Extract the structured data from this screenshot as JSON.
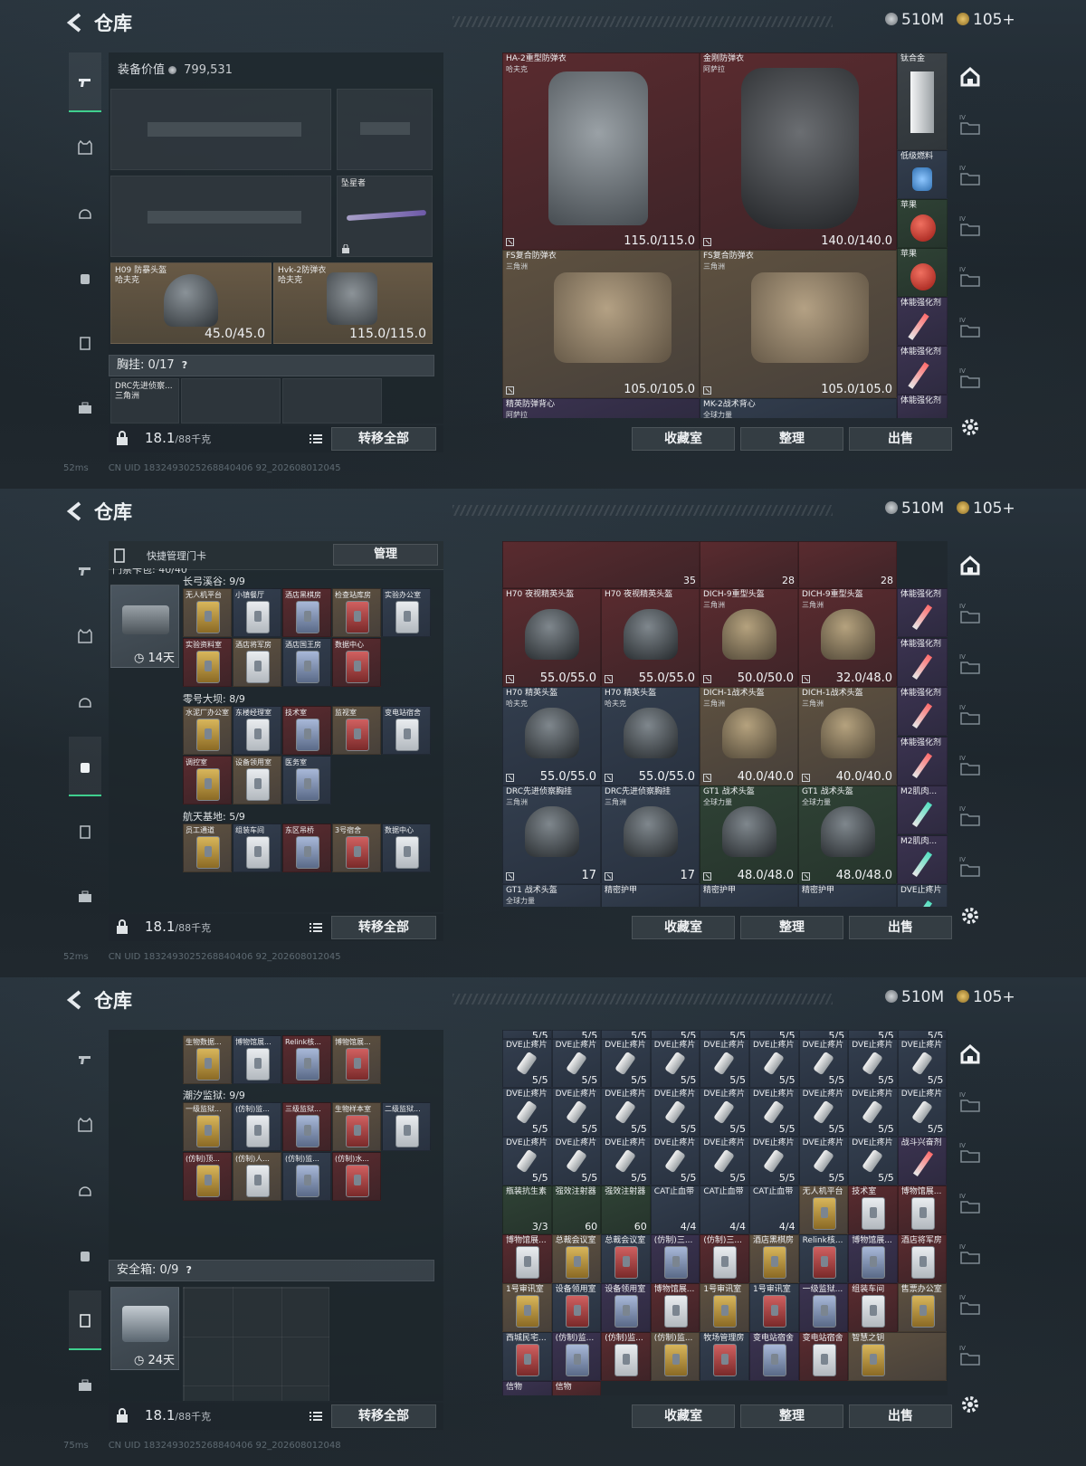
{
  "header": {
    "title": "仓库",
    "currency_silver": "510M",
    "currency_gold": "105+"
  },
  "left": {
    "gear_value_label": "装备价值",
    "gear_value": "799,531",
    "star_slot": "坠星者",
    "helmet": {
      "name": "H09 防暴头盔",
      "sub": "哈夫克",
      "durability": "45.0/45.0"
    },
    "armor": {
      "name": "Hvk-2防弹衣",
      "sub": "哈夫克",
      "durability": "115.0/115.0"
    },
    "chest_label": "胸挂: 0/17",
    "chest_item": "DRC先进侦察...",
    "chest_item_sub": "三角洲",
    "weight": "18.1",
    "weight_unit": "/88千克",
    "transfer_all": "转移全部",
    "quick_card_label": "快捷管理门卡",
    "manage": "管理",
    "card_pack": "门禁卡包: 40/40",
    "days_1": "14天",
    "safe_label": "安全箱: 0/9",
    "days_2": "24天",
    "help": "?"
  },
  "groups": {
    "g1": {
      "title": "长弓溪谷: 9/9",
      "cards": [
        "无人机平台",
        "小镇餐厅",
        "酒店黑棋房",
        "检查站库房",
        "实验办公室",
        "实验资料室",
        "酒店将军房",
        "酒店国王房",
        "数据中心"
      ]
    },
    "g2": {
      "title": "零号大坝: 8/9",
      "cards": [
        "水泥厂办公室",
        "东楼经理室",
        "技术室",
        "监视室",
        "变电站宿舍",
        "调控室",
        "设备领用室",
        "医务室"
      ]
    },
    "g3": {
      "title": "航天基地: 5/9",
      "cards": [
        "员工通道",
        "组装车间",
        "东区吊桥",
        "3号宿舍",
        "数据中心"
      ]
    },
    "g4_top": [
      "生物数据...",
      "博物馆展...",
      "Relink核...",
      "博物馆展..."
    ],
    "g4": {
      "title": "潮汐监狱: 9/9",
      "cards": [
        "一级监狱...",
        "(仿制)监...",
        "三级监狱...",
        "生物样本室",
        "二级监狱...",
        "(仿制)顶...",
        "(仿制)人...",
        "(仿制)监...",
        "(仿制)水..."
      ]
    }
  },
  "right": {
    "s1": [
      {
        "name": "HA-2重型防弹衣",
        "sub": "哈夫克",
        "val": "115.0/115.0"
      },
      {
        "name": "金刚防弹衣",
        "sub": "阿萨拉",
        "val": "140.0/140.0"
      },
      {
        "name": "FS复合防弹衣",
        "sub": "三角洲",
        "val": "105.0/105.0"
      },
      {
        "name": "FS复合防弹衣",
        "sub": "三角洲",
        "val": "105.0/105.0"
      },
      {
        "name": "精英防弹背心",
        "sub": "阿萨拉",
        "val": ""
      },
      {
        "name": "MK-2战术背心",
        "sub": "全球力量",
        "val": ""
      }
    ],
    "s1_side": [
      "钛合金",
      "低级燃料",
      "苹果",
      "苹果",
      "体能强化剂",
      "体能强化剂",
      "体能强化剂"
    ],
    "s2_top": [
      "35",
      "28",
      "28"
    ],
    "s2": [
      {
        "name": "H70 夜视精英头盔",
        "sub": "",
        "val": "55.0/55.0"
      },
      {
        "name": "H70 夜视精英头盔",
        "sub": "",
        "val": "55.0/55.0"
      },
      {
        "name": "DICH-9重型头盔",
        "sub": "三角洲",
        "val": "50.0/50.0"
      },
      {
        "name": "DICH-9重型头盔",
        "sub": "三角洲",
        "val": "32.0/48.0"
      },
      {
        "name": "H70 精英头盔",
        "sub": "哈夫克",
        "val": "55.0/55.0"
      },
      {
        "name": "H70 精英头盔",
        "sub": "哈夫克",
        "val": "55.0/55.0"
      },
      {
        "name": "DICH-1战术头盔",
        "sub": "三角洲",
        "val": "40.0/40.0"
      },
      {
        "name": "DICH-1战术头盔",
        "sub": "三角洲",
        "val": "40.0/40.0"
      },
      {
        "name": "DRC先进侦察胸挂",
        "sub": "三角洲",
        "val": "17"
      },
      {
        "name": "DRC先进侦察胸挂",
        "sub": "三角洲",
        "val": "17"
      },
      {
        "name": "GT1 战术头盔",
        "sub": "全球力量",
        "val": "48.0/48.0"
      },
      {
        "name": "GT1 战术头盔",
        "sub": "全球力量",
        "val": "48.0/48.0"
      },
      {
        "name": "GT1 战术头盔",
        "sub": "全球力量",
        "val": ""
      },
      {
        "name": "精密护甲",
        "sub": "",
        "val": ""
      },
      {
        "name": "精密护甲",
        "sub": "",
        "val": ""
      },
      {
        "name": "精密护甲",
        "sub": "",
        "val": ""
      }
    ],
    "s2_side": [
      "体能强化剂",
      "体能强化剂",
      "体能强化剂",
      "体能强化剂",
      "M2肌肉...",
      "M2肌肉...",
      "DVE止疼片"
    ],
    "s3_pill": "DVE止疼片",
    "s3_pill_qty": "5/5",
    "s3_combat": "战斗兴奋剂",
    "s3_row4": [
      {
        "name": "瓶装抗生素",
        "q": "3/3"
      },
      {
        "name": "强效注射器",
        "q": "60"
      },
      {
        "name": "强效注射器",
        "q": "60"
      },
      {
        "name": "CAT止血带",
        "q": "4/4"
      },
      {
        "name": "CAT止血带",
        "q": "4/4"
      },
      {
        "name": "CAT止血带",
        "q": "4/4"
      },
      {
        "name": "无人机平台",
        "q": ""
      },
      {
        "name": "技术室",
        "q": ""
      },
      {
        "name": "博物馆展...",
        "q": ""
      }
    ],
    "s3_row5": [
      "博物馆展...",
      "总裁会议室",
      "总裁会议室",
      "(仿制)三...",
      "(仿制)三...",
      "酒店黑棋房",
      "Relink核...",
      "博物馆展...",
      "酒店将军房"
    ],
    "s3_row6": [
      "1号审讯室",
      "设备领用室",
      "设备领用室",
      "博物馆展...",
      "1号审讯室",
      "1号审讯室",
      "一级监狱...",
      "组装车间",
      "售票办公室"
    ],
    "s3_row7": [
      "西城民宅...",
      "(仿制)监...",
      "(仿制)监...",
      "(仿制)监...",
      "牧场管理房",
      "变电站宿舍",
      "变电站宿舍",
      "智慧之钥"
    ],
    "s3_row8": [
      "信物",
      "信物"
    ],
    "collection": "收藏室",
    "sort": "整理",
    "sell": "出售"
  },
  "status": {
    "ping1": "52ms",
    "uid1": "CN UID 1832493025268840406 92_202608012045",
    "ping3": "75ms",
    "uid3": "CN UID 1832493025268840406 92_202608012048"
  }
}
